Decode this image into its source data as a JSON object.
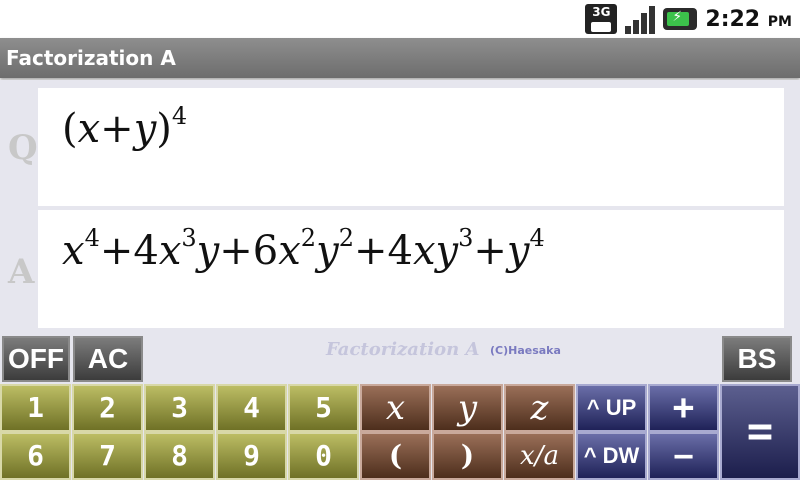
{
  "status_bar": {
    "network": "3G",
    "time": "2:22",
    "ampm": "PM",
    "icons": [
      "network-3g-icon",
      "signal-icon",
      "battery-charging-icon"
    ]
  },
  "title_bar": {
    "title": "Factorization A"
  },
  "labels": {
    "question": "Q",
    "answer": "A"
  },
  "question": {
    "parts": [
      "(",
      "x",
      "+",
      "y",
      ")",
      "4"
    ]
  },
  "answer": {
    "parts": [
      "x",
      "4",
      "+4",
      "x",
      "3",
      "y",
      "+6",
      "x",
      "2",
      "y",
      "2",
      "+4",
      "xy",
      "3",
      "+",
      "y",
      "4"
    ]
  },
  "branding": {
    "app_name": "Factorization A",
    "copyright": "(C)Haesaka"
  },
  "keys": {
    "off": "OFF",
    "ac": "AC",
    "bs": "BS",
    "digits_row1": [
      "1",
      "2",
      "3",
      "4",
      "5"
    ],
    "digits_row2": [
      "6",
      "7",
      "8",
      "9",
      "0"
    ],
    "open_paren": "(",
    "close_paren": ")",
    "var_x": "x",
    "var_y": "y",
    "var_z": "z",
    "var_xa": "x/a",
    "up": "^ UP",
    "down": "^ DW",
    "plus": "+",
    "minus": "—",
    "equals": "="
  },
  "colors": {
    "title_bar": "#7a7a7a",
    "number_keys": "#8f9138",
    "variable_keys": "#6b4634",
    "operator_keys": "#2e3170"
  }
}
